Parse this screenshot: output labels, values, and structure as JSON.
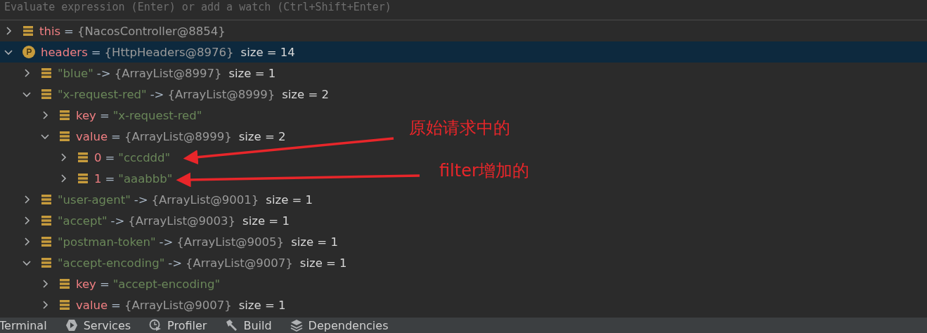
{
  "evaluate_field": {
    "placeholder": "Evaluate expression (Enter) or add a watch (Ctrl+Shift+Enter)"
  },
  "variables": [
    {
      "kind": "field",
      "name": "this",
      "op": "=",
      "value": {
        "kind": "object",
        "text": "{NacosController@8854}"
      },
      "expanded": false,
      "selected": false
    },
    {
      "kind": "parameter",
      "name": "headers",
      "op": "=",
      "value": {
        "kind": "object",
        "text": "{HttpHeaders@8976}"
      },
      "size": "size = 14",
      "expanded": true,
      "selected": true,
      "children": [
        {
          "kind": "entry",
          "name": "\"blue\"",
          "op": "->",
          "value": {
            "kind": "object",
            "text": "{ArrayList@8997}"
          },
          "size": "size = 1",
          "expanded": false,
          "selected": false
        },
        {
          "kind": "entry",
          "name": "\"x-request-red\"",
          "op": "->",
          "value": {
            "kind": "object",
            "text": "{ArrayList@8999}"
          },
          "size": "size = 2",
          "expanded": true,
          "selected": false,
          "children": [
            {
              "kind": "field",
              "name": "key",
              "op": "=",
              "value": {
                "kind": "string",
                "text": "\"x-request-red\""
              },
              "expanded": false,
              "selected": false
            },
            {
              "kind": "field",
              "name": "value",
              "op": "=",
              "value": {
                "kind": "object",
                "text": "{ArrayList@8999}"
              },
              "size": "size = 2",
              "expanded": true,
              "selected": false,
              "children": [
                {
                  "kind": "field",
                  "name": "0",
                  "op": "=",
                  "value": {
                    "kind": "string",
                    "text": "\"cccddd\""
                  },
                  "expanded": false,
                  "selected": false
                },
                {
                  "kind": "field",
                  "name": "1",
                  "op": "=",
                  "value": {
                    "kind": "string",
                    "text": "\"aaabbb\""
                  },
                  "expanded": false,
                  "selected": false
                }
              ]
            }
          ]
        },
        {
          "kind": "entry",
          "name": "\"user-agent\"",
          "op": "->",
          "value": {
            "kind": "object",
            "text": "{ArrayList@9001}"
          },
          "size": "size = 1",
          "expanded": false,
          "selected": false
        },
        {
          "kind": "entry",
          "name": "\"accept\"",
          "op": "->",
          "value": {
            "kind": "object",
            "text": "{ArrayList@9003}"
          },
          "size": "size = 1",
          "expanded": false,
          "selected": false
        },
        {
          "kind": "entry",
          "name": "\"postman-token\"",
          "op": "->",
          "value": {
            "kind": "object",
            "text": "{ArrayList@9005}"
          },
          "size": "size = 1",
          "expanded": false,
          "selected": false
        },
        {
          "kind": "entry",
          "name": "\"accept-encoding\"",
          "op": "->",
          "value": {
            "kind": "object",
            "text": "{ArrayList@9007}"
          },
          "size": "size = 1",
          "expanded": true,
          "selected": false,
          "children": [
            {
              "kind": "field",
              "name": "key",
              "op": "=",
              "value": {
                "kind": "string",
                "text": "\"accept-encoding\""
              },
              "expanded": false,
              "selected": false
            },
            {
              "kind": "field",
              "name": "value",
              "op": "=",
              "value": {
                "kind": "object",
                "text": "{ArrayList@9007}"
              },
              "size": "size = 1",
              "expanded": false,
              "selected": false
            }
          ]
        }
      ]
    }
  ],
  "annotations": [
    "原始请求中的",
    "filter增加的"
  ],
  "tool_tabs": [
    {
      "kind": "plain",
      "label": "Terminal"
    },
    {
      "kind": "services",
      "label": "Services"
    },
    {
      "kind": "profiler",
      "label": "Profiler"
    },
    {
      "kind": "build",
      "label": "Build"
    },
    {
      "kind": "dependencies",
      "label": "Dependencies"
    }
  ]
}
